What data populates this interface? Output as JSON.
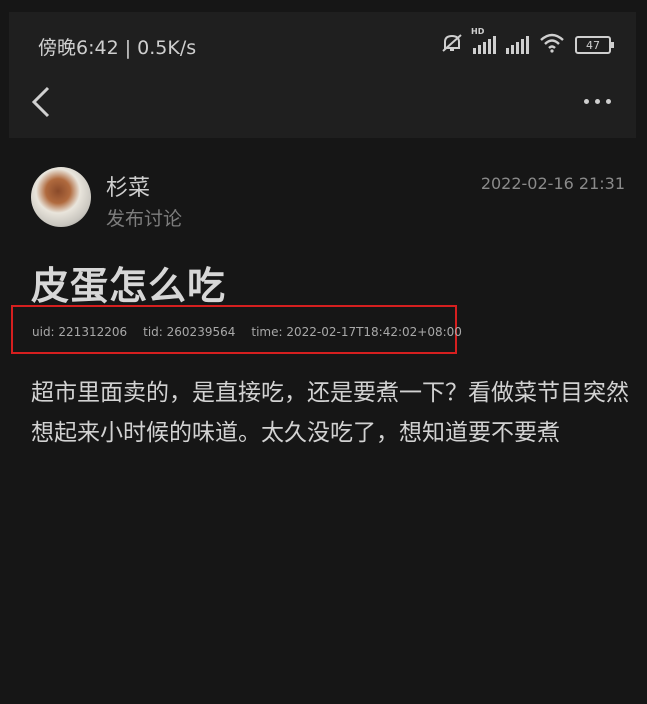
{
  "status_bar": {
    "time": "傍晚6:42 | 0.5K/s",
    "hd_label": "HD",
    "battery": "47",
    "icons": [
      "mute-icon",
      "signal-icon",
      "signal-icon",
      "wifi-icon",
      "battery-icon"
    ]
  },
  "nav": {
    "back_icon": "chevron-left-icon",
    "more_icon": "more-horizontal-icon"
  },
  "post": {
    "author": "杉菜",
    "action": "发布讨论",
    "date": "2022-02-16 21:31",
    "title": "皮蛋怎么吃",
    "meta": {
      "uid": "uid: 221312206",
      "tid": "tid: 260239564",
      "time": "time: 2022-02-17T18:42:02+08:00"
    },
    "body": "超市里面卖的，是直接吃，还是要煮一下？看做菜节目突然想起来小时候的味道。太久没吃了，想知道要不要煮"
  },
  "colors": {
    "background": "#161616",
    "highlight_box": "#d61f1f"
  }
}
